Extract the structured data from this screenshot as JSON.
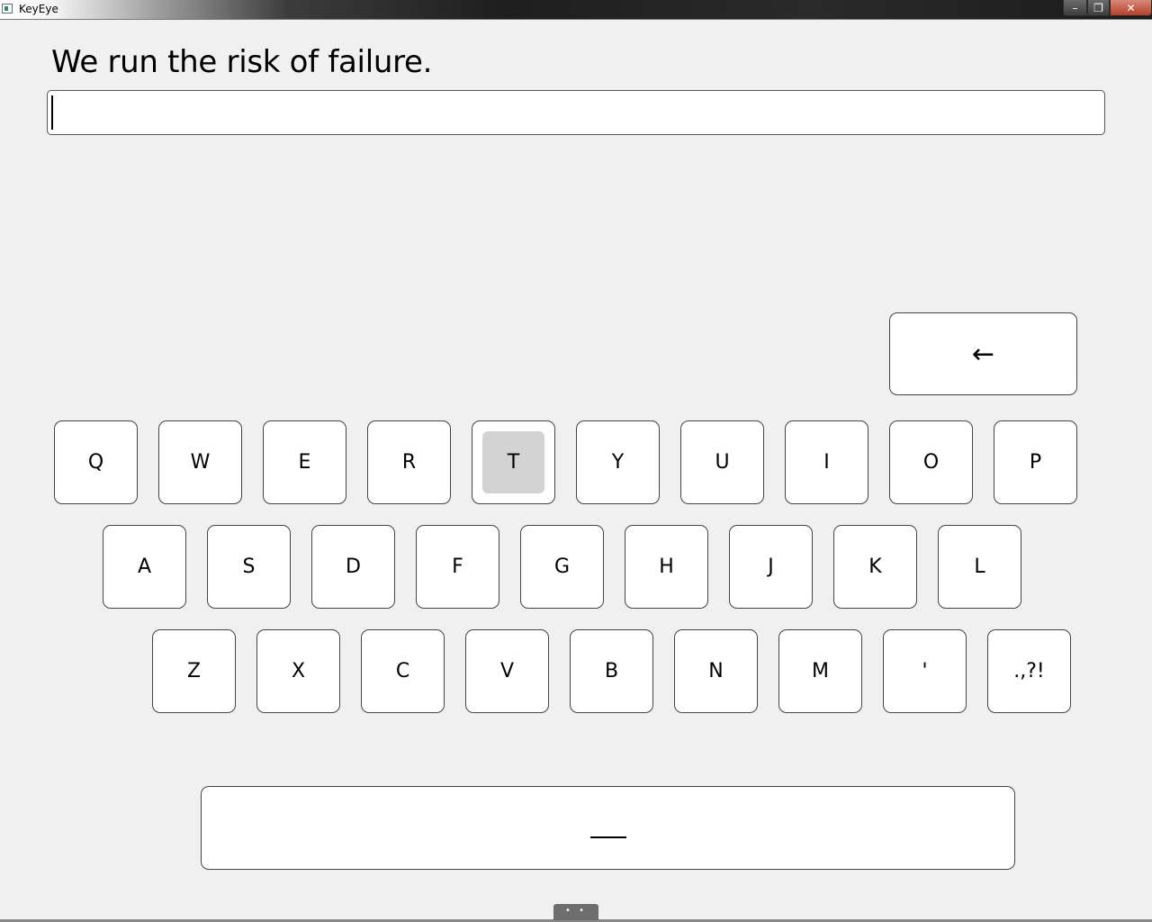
{
  "window": {
    "title": "KeyEye",
    "minimize_glyph": "–",
    "maximize_glyph": "❐",
    "close_glyph": "✕"
  },
  "prompt": {
    "sentence": "We run the risk of failure."
  },
  "input": {
    "value": ""
  },
  "keyboard": {
    "backspace_label": "←",
    "row1": [
      "Q",
      "W",
      "E",
      "R",
      "T",
      "Y",
      "U",
      "I",
      "O",
      "P"
    ],
    "row2": [
      "A",
      "S",
      "D",
      "F",
      "G",
      "H",
      "J",
      "K",
      "L"
    ],
    "row3": [
      "Z",
      "X",
      "C",
      "V",
      "B",
      "N",
      "M",
      "'",
      ".,?!"
    ],
    "highlighted_key": "T",
    "space_label": ""
  },
  "handle": {
    "label": "• •"
  },
  "colors": {
    "background": "#f0f0f0",
    "key_fill": "#ffffff",
    "key_border": "#444444",
    "highlight": "#d3d3d3"
  }
}
